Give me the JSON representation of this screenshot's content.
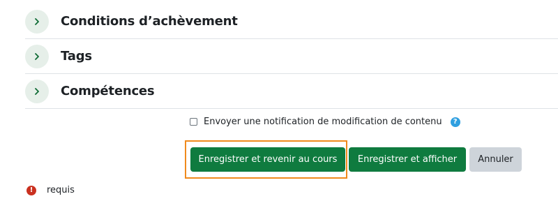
{
  "sections": [
    {
      "title": "Conditions d’achèvement"
    },
    {
      "title": "Tags"
    },
    {
      "title": "Compétences"
    }
  ],
  "notification": {
    "label": "Envoyer une notification de modification de contenu",
    "checked": false,
    "help_glyph": "?"
  },
  "buttons": {
    "save_return": "Enregistrer et revenir au cours",
    "save_display": "Enregistrer et afficher",
    "cancel": "Annuler"
  },
  "required": {
    "icon_glyph": "!",
    "label": "requis"
  },
  "colors": {
    "primary": "#0f7b3f",
    "secondary": "#ced4da",
    "highlight": "#f08a1c",
    "required": "#ca3120",
    "help": "#2f9fe0"
  },
  "icons": {
    "section_toggle": "chevron-right-icon",
    "help": "question-circle-icon",
    "required": "exclamation-circle-icon"
  }
}
